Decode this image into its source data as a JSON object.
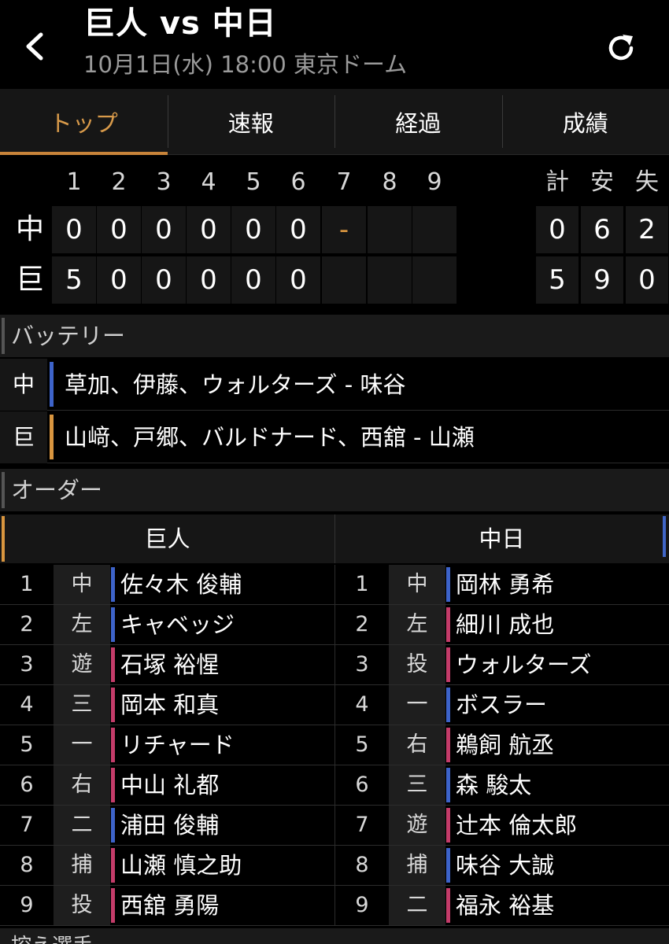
{
  "header": {
    "title": "巨人 vs 中日",
    "subtitle": "10月1日(水) 18:00 東京ドーム",
    "back_icon": "chevron-left-icon",
    "refresh_icon": "refresh-icon"
  },
  "tabs": [
    {
      "label": "トップ",
      "active": true
    },
    {
      "label": "速報",
      "active": false
    },
    {
      "label": "経過",
      "active": false
    },
    {
      "label": "成績",
      "active": false
    }
  ],
  "scoreboard": {
    "innings": [
      "1",
      "2",
      "3",
      "4",
      "5",
      "6",
      "7",
      "8",
      "9"
    ],
    "totals_headers": [
      "計",
      "安",
      "失"
    ],
    "teams": [
      {
        "label": "中",
        "innings": [
          "0",
          "0",
          "0",
          "0",
          "0",
          "0",
          "-",
          "",
          ""
        ],
        "totals": [
          "0",
          "6",
          "2"
        ]
      },
      {
        "label": "巨",
        "innings": [
          "5",
          "0",
          "0",
          "0",
          "0",
          "0",
          "",
          "",
          ""
        ],
        "totals": [
          "5",
          "9",
          "0"
        ]
      }
    ]
  },
  "battery": {
    "heading": "バッテリー",
    "rows": [
      {
        "team": "中",
        "names": "草加、伊藤、ウォルターズ - 味谷",
        "color": "#3d63c9"
      },
      {
        "team": "巨",
        "names": "山﨑、戸郷、バルドナード、西舘 - 山瀬",
        "color": "#d8953f"
      }
    ]
  },
  "order": {
    "heading": "オーダー",
    "home_team": "巨人",
    "away_team": "中日",
    "home": [
      {
        "num": "1",
        "pos": "中",
        "name": "佐々木 俊輔",
        "color": "#3d63c9"
      },
      {
        "num": "2",
        "pos": "左",
        "name": "キャベッジ",
        "color": "#3d63c9"
      },
      {
        "num": "3",
        "pos": "遊",
        "name": "石塚 裕惺",
        "color": "#c43c6a"
      },
      {
        "num": "4",
        "pos": "三",
        "name": "岡本 和真",
        "color": "#c43c6a"
      },
      {
        "num": "5",
        "pos": "一",
        "name": "リチャード",
        "color": "#c43c6a"
      },
      {
        "num": "6",
        "pos": "右",
        "name": "中山 礼都",
        "color": "#c43c6a"
      },
      {
        "num": "7",
        "pos": "二",
        "name": "浦田 俊輔",
        "color": "#3d63c9"
      },
      {
        "num": "8",
        "pos": "捕",
        "name": "山瀬 慎之助",
        "color": "#c43c6a"
      },
      {
        "num": "9",
        "pos": "投",
        "name": "西舘 勇陽",
        "color": "#c43c6a"
      }
    ],
    "away": [
      {
        "num": "1",
        "pos": "中",
        "name": "岡林 勇希",
        "color": "#3d63c9"
      },
      {
        "num": "2",
        "pos": "左",
        "name": "細川 成也",
        "color": "#c43c6a"
      },
      {
        "num": "3",
        "pos": "投",
        "name": "ウォルターズ",
        "color": "#c43c6a"
      },
      {
        "num": "4",
        "pos": "一",
        "name": "ボスラー",
        "color": "#3d63c9"
      },
      {
        "num": "5",
        "pos": "右",
        "name": "鵜飼 航丞",
        "color": "#c43c6a"
      },
      {
        "num": "6",
        "pos": "三",
        "name": "森 駿太",
        "color": "#3d63c9"
      },
      {
        "num": "7",
        "pos": "遊",
        "name": "辻本 倫太郎",
        "color": "#c43c6a"
      },
      {
        "num": "8",
        "pos": "捕",
        "name": "味谷 大誠",
        "color": "#3d63c9"
      },
      {
        "num": "9",
        "pos": "二",
        "name": "福永 裕基",
        "color": "#c43c6a"
      }
    ]
  },
  "next_section": "控え選手",
  "colors": {
    "accent": "#d8953f",
    "background": "#000000",
    "cell": "#161616",
    "blue": "#3d63c9",
    "red": "#c43c6a"
  }
}
